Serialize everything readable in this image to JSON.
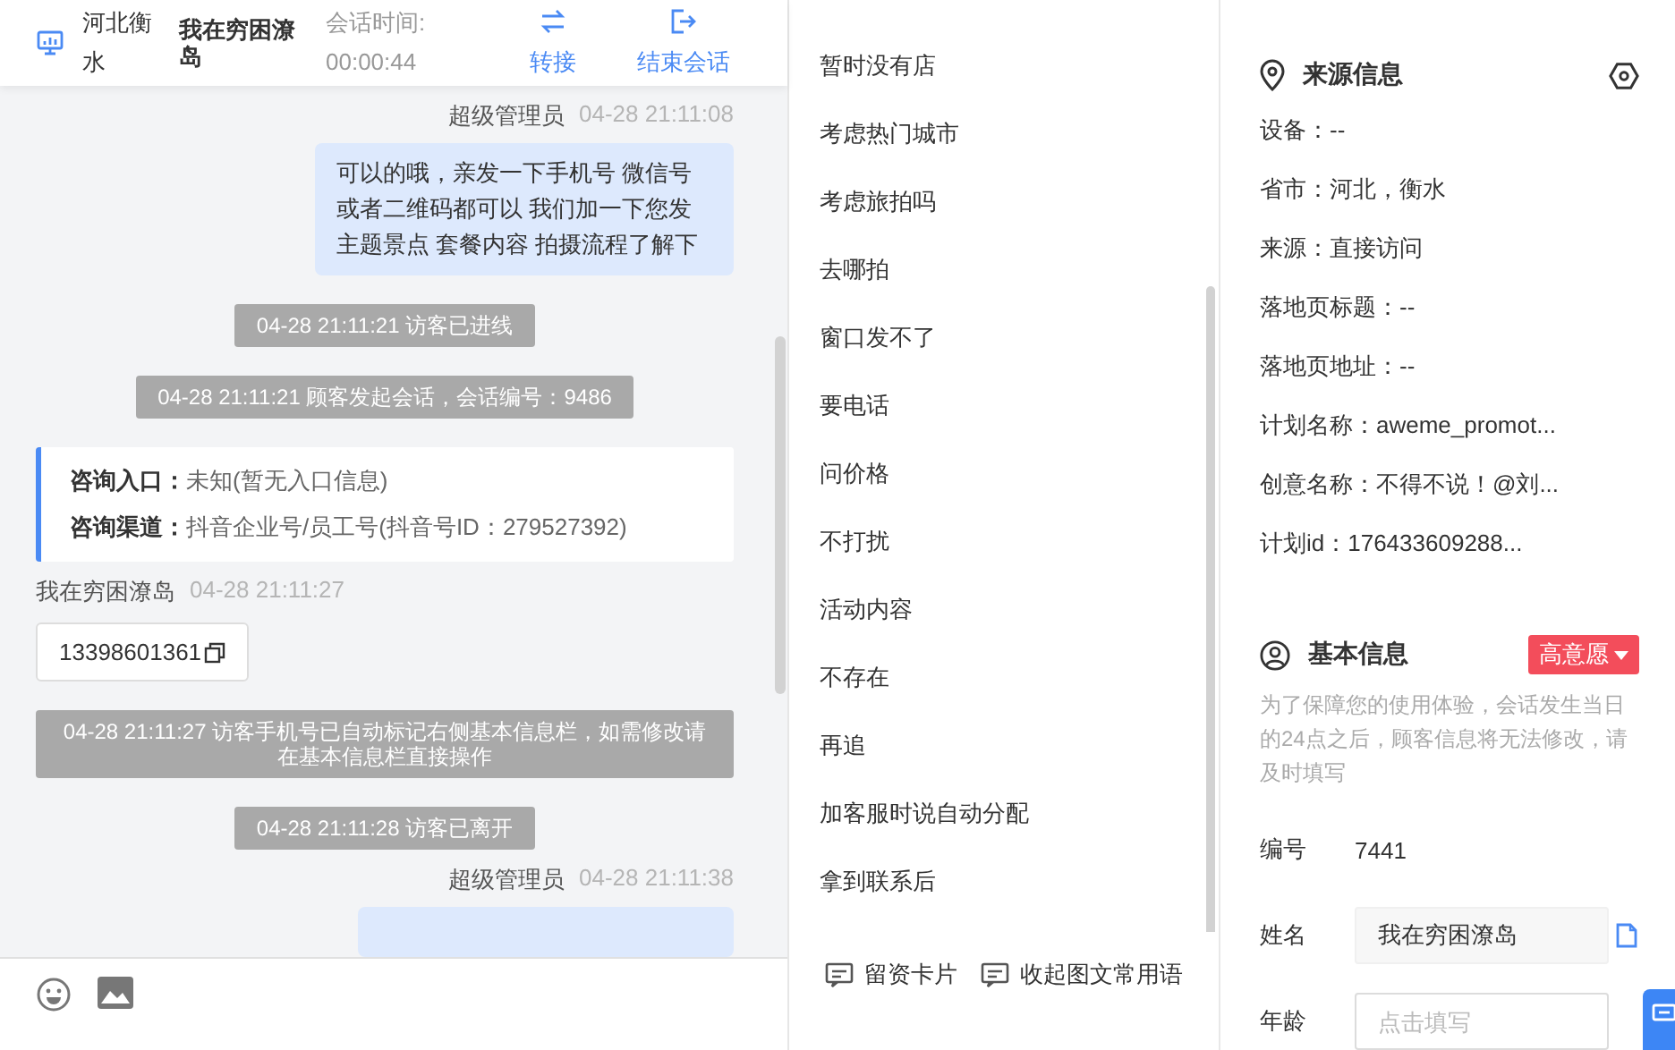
{
  "header": {
    "location": "河北衡水",
    "visitor_name": "我在穷困潦岛",
    "duration_label": "会话时间:",
    "duration": "00:00:44",
    "actions": [
      {
        "kind": "transfer",
        "label": "转接"
      },
      {
        "kind": "end",
        "label": "结束会话"
      }
    ]
  },
  "messages": [
    {
      "kind": "agent",
      "sender": "超级管理员",
      "time": "04-28 21:11:08",
      "text": "可以的哦，亲发一下手机号 微信号或者二维码都可以 我们加一下您发主题景点 套餐内容 拍摄流程了解下"
    },
    {
      "kind": "system",
      "text": "04-28 21:11:21 访客已进线"
    },
    {
      "kind": "system",
      "text": "04-28 21:11:21 顾客发起会话，会话编号：9486"
    },
    {
      "kind": "info_card",
      "rows": [
        {
          "label": "咨询入口：",
          "value": "未知(暂无入口信息)"
        },
        {
          "label": "咨询渠道：",
          "value": "抖音企业号/员工号(抖音号ID：279527392)"
        }
      ]
    },
    {
      "kind": "visitor",
      "sender": "我在穷困潦岛",
      "time": "04-28 21:11:27",
      "phone": "13398601361"
    },
    {
      "kind": "system",
      "text": "04-28 21:11:27 访客手机号已自动标记右侧基本信息栏，如需修改请在基本信息栏直接操作"
    },
    {
      "kind": "system",
      "text": "04-28 21:11:28 访客已离开"
    },
    {
      "kind": "agent",
      "sender": "超级管理员",
      "time": "04-28 21:11:38"
    }
  ],
  "phrases": [
    "暂时没有店",
    "考虑热门城市",
    "考虑旅拍吗",
    "去哪拍",
    "窗口发不了",
    "要电话",
    "问价格",
    "不打扰",
    "活动内容",
    "不存在",
    "再追",
    "加客服时说自动分配",
    "拿到联系后"
  ],
  "phrase_actions": [
    "留资卡片",
    "收起图文常用语"
  ],
  "source_info": {
    "title": "来源信息",
    "rows": [
      "设备：--",
      "省市：河北，衡水",
      "来源：直接访问",
      "落地页标题：--",
      "落地页地址：--",
      "计划名称：aweme_promot...",
      "创意名称：不得不说！@刘...",
      "计划id：176433609288..."
    ]
  },
  "basic_info": {
    "title": "基本信息",
    "intent": "高意愿",
    "notice": "为了保障您的使用体验，会话发生当日的24点之后，顾客信息将无法修改，请及时填写",
    "fields": [
      {
        "kind": "text",
        "label": "编号",
        "value": "7441"
      },
      {
        "kind": "input",
        "label": "姓名",
        "value": "我在穷困潦岛"
      },
      {
        "kind": "input",
        "label": "年龄",
        "placeholder": "点击填写"
      }
    ]
  }
}
